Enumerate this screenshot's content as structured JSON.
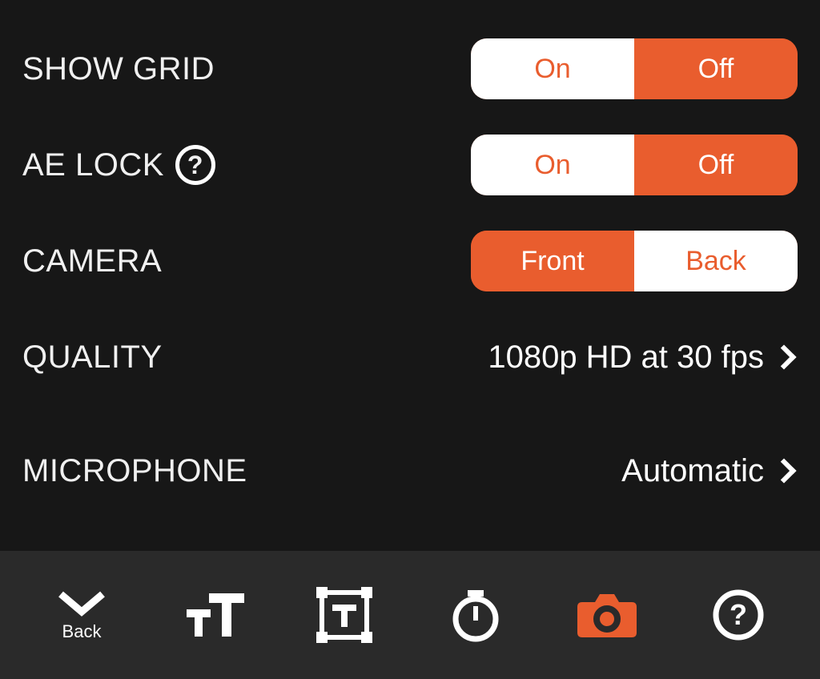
{
  "settings": {
    "showGrid": {
      "label": "SHOW GRID",
      "on": "On",
      "off": "Off",
      "selected": "On"
    },
    "aeLock": {
      "label": "AE LOCK",
      "on": "On",
      "off": "Off",
      "selected": "On"
    },
    "camera": {
      "label": "CAMERA",
      "front": "Front",
      "back": "Back",
      "selected": "Back"
    },
    "quality": {
      "label": "QUALITY",
      "value": "1080p HD at 30 fps"
    },
    "microphone": {
      "label": "MICROPHONE",
      "value": "Automatic"
    }
  },
  "toolbar": {
    "back": "Back"
  },
  "colors": {
    "accent": "#e95d2e",
    "bg": "#171717",
    "toolbar": "#2a2a2a"
  }
}
